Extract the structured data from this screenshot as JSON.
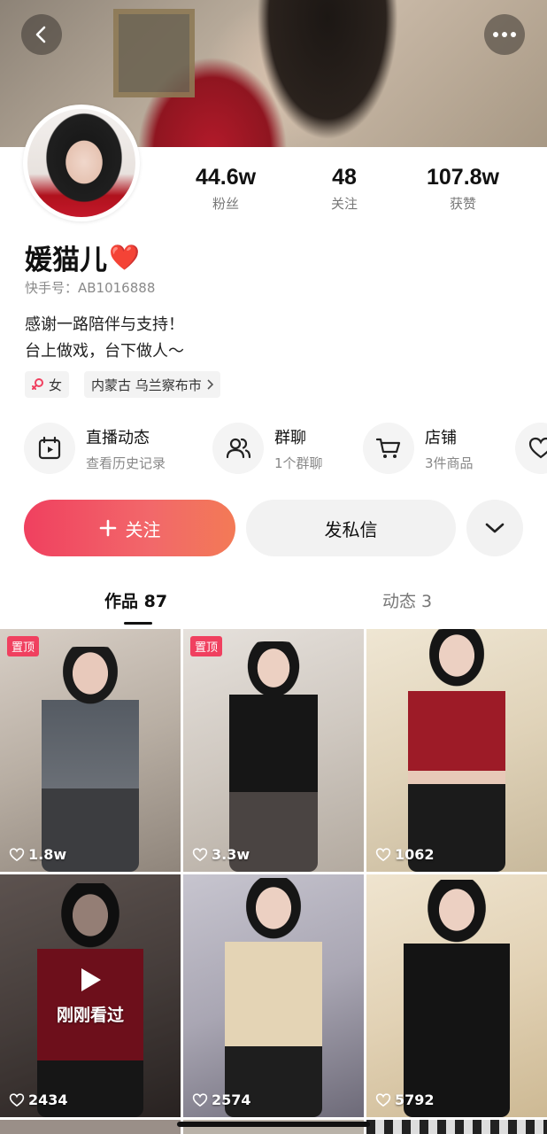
{
  "header": {
    "back_icon": "chevron-left-icon",
    "more_icon": "more-dots-icon"
  },
  "profile": {
    "name": "媛猫儿",
    "name_emoji": "❤️",
    "kuaishou_id": "快手号：AB1016888",
    "bio_line1": "感谢一路陪伴与支持！",
    "bio_line2": "台上做戏，台下做人～",
    "gender_label": "女",
    "location": "内蒙古 乌兰察布市"
  },
  "stats": [
    {
      "value": "44.6w",
      "label": "粉丝"
    },
    {
      "value": "48",
      "label": "关注"
    },
    {
      "value": "107.8w",
      "label": "获赞"
    }
  ],
  "features": [
    {
      "title": "直播动态",
      "subtitle": "查看历史记录",
      "icon": "calendar-play-icon"
    },
    {
      "title": "群聊",
      "subtitle": "1个群聊",
      "icon": "group-users-icon"
    },
    {
      "title": "店铺",
      "subtitle": "3件商品",
      "icon": "cart-icon"
    }
  ],
  "actions": {
    "follow_label": "关注",
    "message_label": "发私信"
  },
  "tabs": [
    {
      "label": "作品 87",
      "active": true
    },
    {
      "label": "动态 3",
      "active": false
    }
  ],
  "works": [
    {
      "likes": "1.8w",
      "pinned": true,
      "pin_label": "置顶"
    },
    {
      "likes": "3.3w",
      "pinned": true,
      "pin_label": "置顶"
    },
    {
      "likes": "1062",
      "pinned": false
    },
    {
      "likes": "2434",
      "pinned": false,
      "watched_label": "刚刚看过"
    },
    {
      "likes": "2574",
      "pinned": false
    },
    {
      "likes": "5792",
      "pinned": false
    }
  ],
  "colors": {
    "accent": "#f0405f",
    "pin_badge": "#f0405f"
  }
}
